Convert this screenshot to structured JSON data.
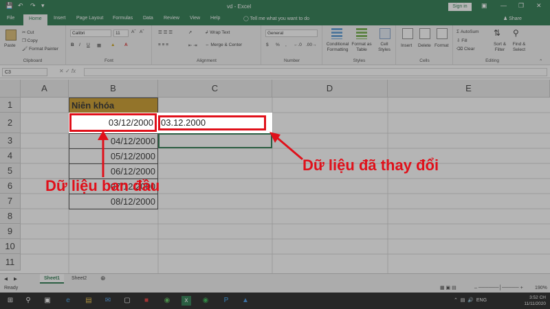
{
  "titlebar": {
    "title": "vd - Excel",
    "sign_in": "Sign in"
  },
  "tabs": [
    "File",
    "Home",
    "Insert",
    "Page Layout",
    "Formulas",
    "Data",
    "Review",
    "View",
    "Help"
  ],
  "tell_me": "Tell me what you want to do",
  "share": "Share",
  "ribbon": {
    "clipboard": {
      "label": "Clipboard",
      "paste": "Paste",
      "cut": "Cut",
      "copy": "Copy",
      "format_painter": "Format Painter"
    },
    "font": {
      "label": "Font",
      "name": "Calibri",
      "size": "11",
      "bold": "B",
      "italic": "I",
      "underline": "U"
    },
    "alignment": {
      "label": "Alignment",
      "wrap": "Wrap Text",
      "merge": "Merge & Center"
    },
    "number": {
      "label": "Number",
      "format": "General",
      "currency": "$",
      "percent": "%",
      "comma": ","
    },
    "styles": {
      "label": "Styles",
      "conditional": "Conditional Formatting",
      "format_table": "Format as Table",
      "cell_styles": "Cell Styles"
    },
    "cells": {
      "label": "Cells",
      "insert": "Insert",
      "delete": "Delete",
      "format": "Format"
    },
    "editing": {
      "label": "Editing",
      "autosum": "AutoSum",
      "fill": "Fill",
      "clear": "Clear",
      "sort": "Sort & Filter",
      "find": "Find & Select"
    }
  },
  "formula_bar": {
    "name_box": "C3",
    "value": ""
  },
  "grid": {
    "columns": [
      "A",
      "B",
      "C",
      "D",
      "E"
    ],
    "rows": [
      "1",
      "2",
      "3",
      "4",
      "5",
      "6",
      "7",
      "8",
      "9",
      "10",
      "11"
    ],
    "b1": "Niên khóa",
    "b_values": [
      "03/12/2000",
      "04/12/2000",
      "05/12/2000",
      "06/12/2000",
      "07/12/2000",
      "08/12/2000"
    ],
    "c2": "03.12.2000"
  },
  "annotations": {
    "original": "Dữ liệu ban đầu",
    "changed": "Dữ liệu đã thay đổi"
  },
  "sheets": [
    "Sheet1",
    "Sheet2"
  ],
  "status": {
    "ready": "Ready",
    "zoom": "190%"
  },
  "taskbar": {
    "lang": "ENG",
    "time": "3:52 CH",
    "date": "11/11/2020"
  }
}
